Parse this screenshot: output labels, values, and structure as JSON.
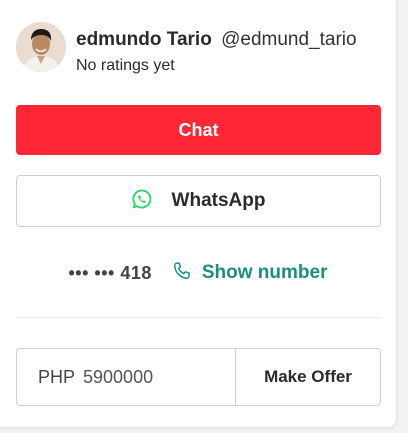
{
  "seller": {
    "name": "edmundo Tario",
    "handle": "@edmund_tario",
    "ratings": "No ratings yet"
  },
  "actions": {
    "chat_label": "Chat",
    "whatsapp_label": "WhatsApp"
  },
  "phone": {
    "masked": "••• ••• 418",
    "show_label": "Show number"
  },
  "offer": {
    "currency": "PHP",
    "amount": "5900000",
    "button_label": "Make Offer"
  },
  "colors": {
    "chat": "#ff2636",
    "whatsapp": "#25d366",
    "link": "#1a8f80"
  },
  "icons": {
    "whatsapp": "whatsapp-icon",
    "phone": "phone-icon"
  }
}
